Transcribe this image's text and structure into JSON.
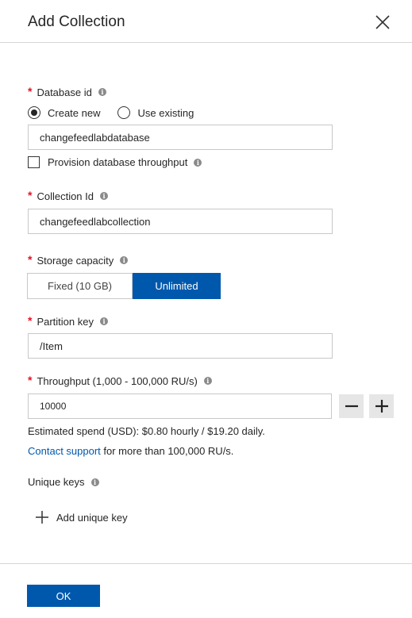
{
  "header": {
    "title": "Add Collection"
  },
  "database": {
    "label": "Database id",
    "required_marker": "*",
    "options": [
      "Create new",
      "Use existing"
    ],
    "selected": "Create new",
    "value": "changefeedlabdatabase",
    "provision_label": "Provision database throughput",
    "provision_checked": false
  },
  "collection": {
    "label": "Collection Id",
    "required_marker": "*",
    "value": "changefeedlabcollection"
  },
  "storage": {
    "label": "Storage capacity",
    "required_marker": "*",
    "options": [
      "Fixed (10 GB)",
      "Unlimited"
    ],
    "selected": "Unlimited"
  },
  "partition": {
    "label": "Partition key",
    "required_marker": "*",
    "value": "/Item"
  },
  "throughput": {
    "label": "Throughput (1,000 - 100,000 RU/s)",
    "required_marker": "*",
    "value": "10000",
    "estimate": "Estimated spend (USD): $0.80 hourly / $19.20 daily.",
    "support_link": "Contact support",
    "support_suffix": " for more than 100,000 RU/s."
  },
  "unique_keys": {
    "label": "Unique keys",
    "add_label": "Add unique key"
  },
  "footer": {
    "ok_label": "OK"
  },
  "icons": {
    "close": "close-icon",
    "info": "info-icon",
    "minus": "minus-icon",
    "plus": "plus-icon"
  },
  "colors": {
    "accent": "#0058ad",
    "required": "#e81123",
    "info": "#8a8a8a"
  }
}
